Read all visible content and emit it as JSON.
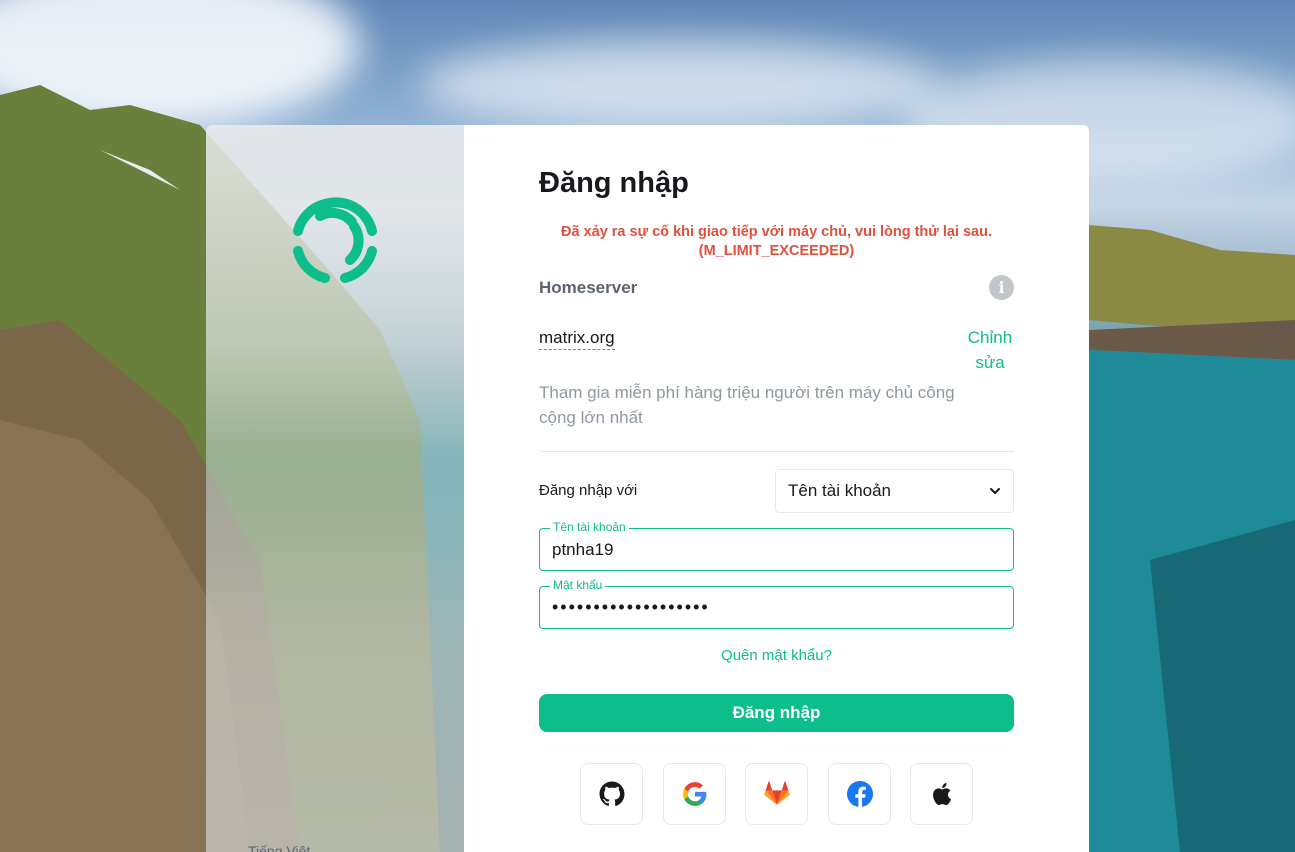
{
  "login": {
    "title": "Đăng nhập",
    "error_line1": "Đã xảy ra sự cố khi giao tiếp với máy chủ, vui lòng thử lại sau.",
    "error_line2": "(M_LIMIT_EXCEEDED)",
    "homeserver_label": "Homeserver",
    "homeserver_name": "matrix.org",
    "homeserver_edit": "Chỉnh sửa",
    "homeserver_desc": "Tham gia miễn phí hàng triệu người trên máy chủ công cộng lớn nhất",
    "login_with_label": "Đăng nhập với",
    "login_with_value": "Tên tài khoản",
    "username_label": "Tên tài khoản",
    "username_value": "ptnha19",
    "password_label": "Mật khẩu",
    "password_value": "•••••••••••••••••••",
    "forgot": "Quên mật khẩu?",
    "submit": "Đăng nhập",
    "sso": [
      "github-icon",
      "google-icon",
      "gitlab-icon",
      "facebook-icon",
      "apple-icon"
    ]
  },
  "side": {
    "language": "Tiếng Việt"
  },
  "colors": {
    "accent": "#0dbd8b",
    "error": "#e0503d",
    "text": "#17191c",
    "secondary": "#8d97a5"
  }
}
